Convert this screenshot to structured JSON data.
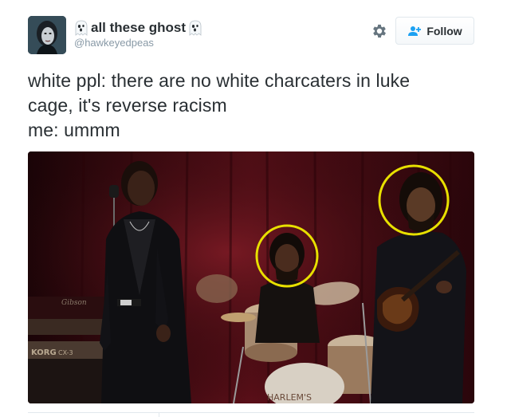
{
  "user": {
    "display_name": "all these ghost",
    "handle": "@hawkeyedpeas",
    "avatar_icon": "avatar-photo",
    "name_emoji": "ghost-emoji"
  },
  "actions": {
    "settings_icon": "gear-icon",
    "follow_label": "Follow",
    "follow_icon": "add-user-icon"
  },
  "tweet": {
    "lines": [
      "white ppl: there are no white charcaters in luke",
      "cage, it's reverse racism",
      "me: ummm"
    ]
  },
  "media": {
    "description_icon": "stage-band-photo",
    "keyboard_brand": "KORG",
    "keyboard_model": "CX-3",
    "organ_brand": "Gibson",
    "drum_text": "HARLEM'S",
    "highlight_color": "#e8e000"
  },
  "colors": {
    "text": "#292f33",
    "muted": "#8899a6",
    "border": "#e1e8ed",
    "link": "#1da1f2"
  }
}
